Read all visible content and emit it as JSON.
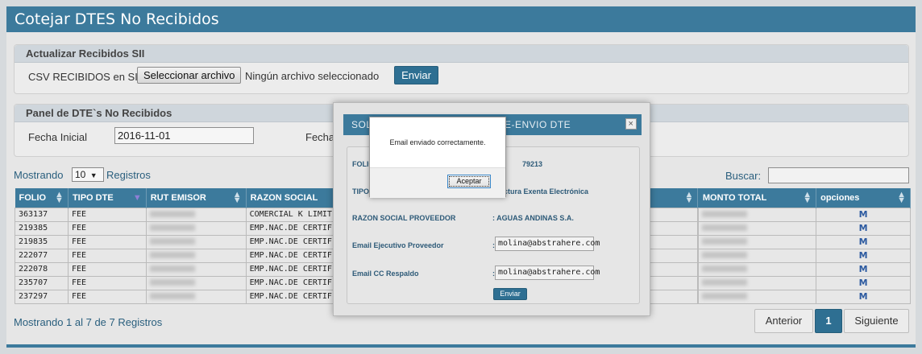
{
  "page": {
    "title": "Cotejar DTES No Recibidos"
  },
  "upload_panel": {
    "title": "Actualizar Recibidos SII",
    "label": "CSV RECIBIDOS en SII",
    "file_button": "Seleccionar archivo",
    "file_status": "Ningún archivo seleccionado",
    "submit": "Enviar"
  },
  "filter_panel": {
    "title": "Panel de DTE`s No Recibidos",
    "fecha_inicial_label": "Fecha Inicial",
    "fecha_inicial_value": "2016-11-01",
    "fecha_final_label": "Fecha"
  },
  "table_controls": {
    "show_prefix": "Mostrando",
    "page_size": "10",
    "show_suffix": "Registros",
    "search_label": "Buscar:"
  },
  "table": {
    "headers": [
      "FOLIO",
      "TIPO DTE",
      "RUT EMISOR",
      "RAZON SOCIAL",
      "",
      "MONTO TOTAL",
      "opciones"
    ],
    "rows": [
      {
        "folio": "363137",
        "tipo": "FEE",
        "razon": "COMERCIAL K LIMIT"
      },
      {
        "folio": "219385",
        "tipo": "FEE",
        "razon": "EMP.NAC.DE CERTIF"
      },
      {
        "folio": "219835",
        "tipo": "FEE",
        "razon": "EMP.NAC.DE CERTIF"
      },
      {
        "folio": "222077",
        "tipo": "FEE",
        "razon": "EMP.NAC.DE CERTIF"
      },
      {
        "folio": "222078",
        "tipo": "FEE",
        "razon": "EMP.NAC.DE CERTIF"
      },
      {
        "folio": "235707",
        "tipo": "FEE",
        "razon": "EMP.NAC.DE CERTIF"
      },
      {
        "folio": "237297",
        "tipo": "FEE",
        "razon": "EMP.NAC.DE CERTIF"
      }
    ],
    "mail_icon": "M"
  },
  "footer": {
    "summary": "Mostrando 1 al 7 de 7 Registros",
    "prev": "Anterior",
    "page": "1",
    "next": "Siguiente"
  },
  "modal": {
    "title_left": "SOL",
    "title_right": "E-ENVIO DTE",
    "close": "×",
    "folio_label": "FOLIO",
    "folio_value": "79213",
    "tipo_label": "TIPO",
    "tipo_value": "ctura Exenta Electrónica",
    "razon_label": "RAZON SOCIAL PROVEEDOR",
    "razon_value": ": AGUAS ANDINAS S.A.",
    "email_ejecutivo_label": "Email Ejecutivo Proveedor",
    "email_ejecutivo_value": "molina@abstrahere.com",
    "email_cc_label": "Email CC Respaldo",
    "email_cc_value": "molina@abstrahere.com",
    "colon": ":",
    "submit": "Enviar"
  },
  "alert": {
    "message": "Email enviado correctamente.",
    "ok": "Aceptar"
  }
}
